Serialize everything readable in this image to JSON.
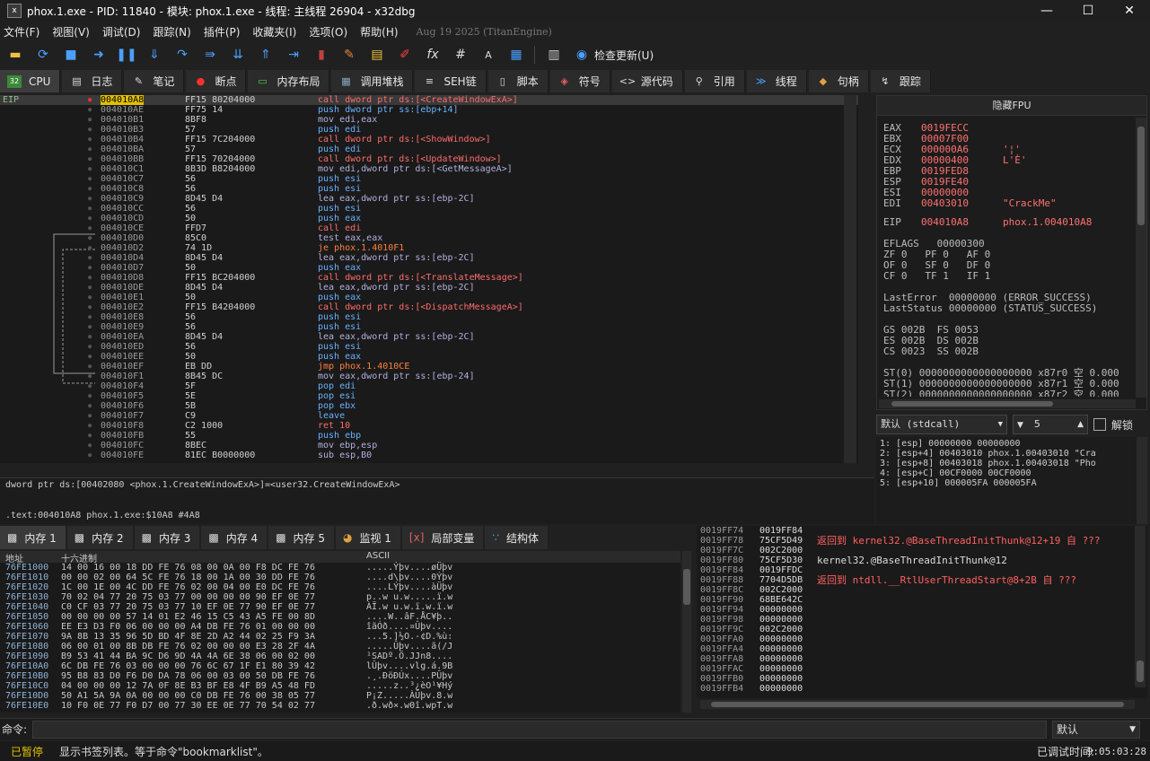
{
  "window": {
    "title": "phox.1.exe - PID: 11840 - 模块: phox.1.exe - 线程: 主线程 26904 - x32dbg",
    "minimize": "—",
    "maximize": "☐",
    "close": "✕"
  },
  "menu": {
    "items": [
      "文件(F)",
      "视图(V)",
      "调试(D)",
      "跟踪(N)",
      "插件(P)",
      "收藏夹(I)",
      "选项(O)",
      "帮助(H)"
    ],
    "build_date": "Aug 19 2025 (TitanEngine)"
  },
  "toolbar": {
    "check_update": "检查更新(U)"
  },
  "tabs": [
    {
      "label": "CPU",
      "icon": "cpu-icon"
    },
    {
      "label": "日志",
      "icon": "log-icon"
    },
    {
      "label": "笔记",
      "icon": "notes-icon"
    },
    {
      "label": "断点",
      "icon": "breakpoint-icon"
    },
    {
      "label": "内存布局",
      "icon": "memory-map-icon"
    },
    {
      "label": "调用堆栈",
      "icon": "callstack-icon"
    },
    {
      "label": "SEH链",
      "icon": "seh-icon"
    },
    {
      "label": "脚本",
      "icon": "script-icon"
    },
    {
      "label": "符号",
      "icon": "symbols-icon"
    },
    {
      "label": "源代码",
      "icon": "source-icon"
    },
    {
      "label": "引用",
      "icon": "references-icon"
    },
    {
      "label": "线程",
      "icon": "threads-icon"
    },
    {
      "label": "句柄",
      "icon": "handles-icon"
    },
    {
      "label": "跟踪",
      "icon": "trace-icon"
    }
  ],
  "disasm": {
    "eip_label": "EIP",
    "rows": [
      {
        "addr": "004010A8",
        "bytes": "FF15 80204000",
        "ins": "call dword ptr ds:[<CreateWindowExA>]",
        "kind": "call",
        "sel": true
      },
      {
        "addr": "004010AE",
        "bytes": "FF75 14",
        "ins": "push dword ptr ss:[ebp+14]",
        "kind": "push"
      },
      {
        "addr": "004010B1",
        "bytes": "8BF8",
        "ins": "mov edi,eax",
        "kind": "mov"
      },
      {
        "addr": "004010B3",
        "bytes": "57",
        "ins": "push edi",
        "kind": "push"
      },
      {
        "addr": "004010B4",
        "bytes": "FF15 7C204000",
        "ins": "call dword ptr ds:[<ShowWindow>]",
        "kind": "call"
      },
      {
        "addr": "004010BA",
        "bytes": "57",
        "ins": "push edi",
        "kind": "push"
      },
      {
        "addr": "004010BB",
        "bytes": "FF15 70204000",
        "ins": "call dword ptr ds:[<UpdateWindow>]",
        "kind": "call"
      },
      {
        "addr": "004010C1",
        "bytes": "8B3D B8204000",
        "ins": "mov edi,dword ptr ds:[<GetMessageA>]",
        "kind": "mov"
      },
      {
        "addr": "004010C7",
        "bytes": "56",
        "ins": "push esi",
        "kind": "push"
      },
      {
        "addr": "004010C8",
        "bytes": "56",
        "ins": "push esi",
        "kind": "push"
      },
      {
        "addr": "004010C9",
        "bytes": "8D45 D4",
        "ins": "lea eax,dword ptr ss:[ebp-2C]",
        "kind": "mov"
      },
      {
        "addr": "004010CC",
        "bytes": "56",
        "ins": "push esi",
        "kind": "push"
      },
      {
        "addr": "004010CD",
        "bytes": "50",
        "ins": "push eax",
        "kind": "push"
      },
      {
        "addr": "004010CE",
        "bytes": "FFD7",
        "ins": "call edi",
        "kind": "call"
      },
      {
        "addr": "004010D0",
        "bytes": "85C0",
        "ins": "test eax,eax",
        "kind": "mov"
      },
      {
        "addr": "004010D2",
        "bytes": "74 1D",
        "ins": "je phox.1.4010F1",
        "kind": "jmp"
      },
      {
        "addr": "004010D4",
        "bytes": "8D45 D4",
        "ins": "lea eax,dword ptr ss:[ebp-2C]",
        "kind": "mov"
      },
      {
        "addr": "004010D7",
        "bytes": "50",
        "ins": "push eax",
        "kind": "push"
      },
      {
        "addr": "004010D8",
        "bytes": "FF15 BC204000",
        "ins": "call dword ptr ds:[<TranslateMessage>]",
        "kind": "call"
      },
      {
        "addr": "004010DE",
        "bytes": "8D45 D4",
        "ins": "lea eax,dword ptr ss:[ebp-2C]",
        "kind": "mov"
      },
      {
        "addr": "004010E1",
        "bytes": "50",
        "ins": "push eax",
        "kind": "push"
      },
      {
        "addr": "004010E2",
        "bytes": "FF15 B4204000",
        "ins": "call dword ptr ds:[<DispatchMessageA>]",
        "kind": "call"
      },
      {
        "addr": "004010E8",
        "bytes": "56",
        "ins": "push esi",
        "kind": "push"
      },
      {
        "addr": "004010E9",
        "bytes": "56",
        "ins": "push esi",
        "kind": "push"
      },
      {
        "addr": "004010EA",
        "bytes": "8D45 D4",
        "ins": "lea eax,dword ptr ss:[ebp-2C]",
        "kind": "mov"
      },
      {
        "addr": "004010ED",
        "bytes": "56",
        "ins": "push esi",
        "kind": "push"
      },
      {
        "addr": "004010EE",
        "bytes": "50",
        "ins": "push eax",
        "kind": "push"
      },
      {
        "addr": "004010EF",
        "bytes": "EB DD",
        "ins": "jmp phox.1.4010CE",
        "kind": "jmp"
      },
      {
        "addr": "004010F1",
        "bytes": "8B45 DC",
        "ins": "mov eax,dword ptr ss:[ebp-24]",
        "kind": "mov"
      },
      {
        "addr": "004010F4",
        "bytes": "5F",
        "ins": "pop edi",
        "kind": "push"
      },
      {
        "addr": "004010F5",
        "bytes": "5E",
        "ins": "pop esi",
        "kind": "push"
      },
      {
        "addr": "004010F6",
        "bytes": "5B",
        "ins": "pop ebx",
        "kind": "push"
      },
      {
        "addr": "004010F7",
        "bytes": "C9",
        "ins": "leave",
        "kind": "push"
      },
      {
        "addr": "004010F8",
        "bytes": "C2 1000",
        "ins": "ret 10",
        "kind": "ret"
      },
      {
        "addr": "004010FB",
        "bytes": "55",
        "ins": "push ebp",
        "kind": "push"
      },
      {
        "addr": "004010FC",
        "bytes": "8BEC",
        "ins": "mov ebp,esp",
        "kind": "mov"
      },
      {
        "addr": "004010FE",
        "bytes": "81EC B0000000",
        "ins": "sub esp,B0",
        "kind": "mov"
      }
    ]
  },
  "info": {
    "line1": "dword ptr ds:[00402080 <phox.1.CreateWindowExA>]=<user32.CreateWindowExA>",
    "line2": ".text:004010A8 phox.1.exe:$10A8 #4A8"
  },
  "fpu": {
    "header": "隐藏FPU",
    "regs": [
      {
        "n": "EAX",
        "v": "0019FECC",
        "c": ""
      },
      {
        "n": "EBX",
        "v": "00007F00",
        "c": ""
      },
      {
        "n": "ECX",
        "v": "000000A6",
        "c": "'¦'"
      },
      {
        "n": "EDX",
        "v": "00000400",
        "c": "L'Ѐ'"
      },
      {
        "n": "EBP",
        "v": "0019FED8",
        "c": ""
      },
      {
        "n": "ESP",
        "v": "0019FE40",
        "c": ""
      },
      {
        "n": "ESI",
        "v": "00000000",
        "c": ""
      },
      {
        "n": "EDI",
        "v": "00403010",
        "c": "\"CrackMe\""
      }
    ],
    "eip": {
      "n": "EIP",
      "v": "004010A8",
      "c": "phox.1.004010A8"
    },
    "eflags": "EFLAGS   00000300",
    "flags1": "ZF 0   PF 0   AF 0",
    "flags2": "OF 0   SF 0   DF 0",
    "flags3": "CF 0   TF 1   IF 1",
    "lasterror": "LastError  00000000 (ERROR_SUCCESS)",
    "laststatus": "LastStatus 00000000 (STATUS_SUCCESS)",
    "seg1": "GS 002B  FS 0053",
    "seg2": "ES 002B  DS 002B",
    "seg3": "CS 0023  SS 002B",
    "st0": "ST(0) 0000000000000000000 x87r0 空 0.000",
    "st1": "ST(1) 0000000000000000000 x87r1 空 0.000",
    "st2": "ST(2) 0000000000000000000 x87r2 空 0.000"
  },
  "callconv": {
    "value": "默认 (stdcall)",
    "count": "5",
    "unlock": "解锁"
  },
  "stack_args": [
    "1: [esp] 00000000 00000000",
    "2: [esp+4] 00403010 phox.1.00403010 \"Cra",
    "3: [esp+8] 00403018 phox.1.00403018 \"Pho",
    "4: [esp+C] 00CF0000 00CF0000",
    "5: [esp+10] 000005FA 000005FA"
  ],
  "dump_tabs": [
    "内存 1",
    "内存 2",
    "内存 3",
    "内存 4",
    "内存 5",
    "监视 1",
    "局部变量",
    "结构体"
  ],
  "dump": {
    "col_addr": "地址",
    "col_hex": "十六进制",
    "col_ascii": "ASCII",
    "rows": [
      {
        "a": "76FE1000",
        "h": "14 00 16 00 18 DD FE 76 08 00 0A 00 F8 DC FE 76",
        "s": ".....Ýþv....øÜþv"
      },
      {
        "a": "76FE1010",
        "h": "00 00 02 00 64 5C FE 76 18 00 1A 00 30 DD FE 76",
        "s": "....d\\þv....0Ýþv"
      },
      {
        "a": "76FE1020",
        "h": "1C 00 1E 00 4C DD FE 76 02 00 04 00 E0 DC FE 76",
        "s": "....LÝþv....àÜþv"
      },
      {
        "a": "76FE1030",
        "h": "70 02 04 77 20 75 03 77 00 00 00 00 90 EF 0E 77",
        "s": "p..w u.w.....ï.w"
      },
      {
        "a": "76FE1040",
        "h": "C0 CF 03 77 20 75 03 77 10 EF 0E 77 90 EF 0E 77",
        "s": "ÀÏ.w u.w.ï.w.ï.w"
      },
      {
        "a": "76FE1050",
        "h": "00 00 00 00 57 14 01 E2 46 15 C5 43 A5 FE 00 8D",
        "s": "....W..âF.ÅC¥þ.."
      },
      {
        "a": "76FE1060",
        "h": "EE E3 D3 F0 06 00 00 00 A4 DB FE 76 01 00 00 00",
        "s": "îãÓð....¤Ûþv...."
      },
      {
        "a": "76FE1070",
        "h": "9A 8B 13 35 96 5D BD 4F 8E 2D A2 44 02 25 F9 3A",
        "s": "...5.]½O.-¢D.%ù:"
      },
      {
        "a": "76FE1080",
        "h": "06 00 01 00 8B DB FE 76 02 00 00 00 E3 28 2F 4A",
        "s": ".....Ûþv....ã(/J"
      },
      {
        "a": "76FE1090",
        "h": "B9 53 41 44 BA 9C D6 9D 4A 4A 6E 38 06 00 02 00",
        "s": "¹SADº.Ö.JJn8...."
      },
      {
        "a": "76FE10A0",
        "h": "6C DB FE 76 03 00 00 00 76 6C 67 1F E1 80 39 42",
        "s": "lÛþv....vlg.á.9B"
      },
      {
        "a": "76FE10B0",
        "h": "95 B8 83 D0 F6 D0 DA 78 06 00 03 00 50 DB FE 76",
        "s": ".¸.ÐöÐÚx....PÛþv"
      },
      {
        "a": "76FE10C0",
        "h": "04 00 00 00 12 7A 0F 8E B3 BF E8 4F B9 A5 48 FD",
        "s": ".....z..³¿èO¹¥Hý"
      },
      {
        "a": "76FE10D0",
        "h": "50 A1 5A 9A 0A 00 00 00 C0 DB FE 76 00 38 05 77",
        "s": "P¡Z.....ÀÛþv.8.w"
      },
      {
        "a": "76FE10E0",
        "h": "10 F0 0E 77 F0 D7 00 77 30 EE 0E 77 70 54 02 77",
        "s": ".ð.wð×.w0î.wpT.w"
      }
    ]
  },
  "stack": {
    "rows": [
      {
        "a": "0019FF74",
        "v": "0019FF84",
        "c": ""
      },
      {
        "a": "0019FF78",
        "v": "75CF5D49",
        "c": "返回到 kernel32.@BaseThreadInitThunk@12+19 自 ???"
      },
      {
        "a": "0019FF7C",
        "v": "002C2000",
        "c": ""
      },
      {
        "a": "0019FF80",
        "v": "75CF5D30",
        "c": "kernel32.@BaseThreadInitThunk@12"
      },
      {
        "a": "0019FF84",
        "v": "0019FFDC",
        "c": ""
      },
      {
        "a": "0019FF88",
        "v": "7704D5DB",
        "c": "返回到 ntdll.__RtlUserThreadStart@8+2B 自 ???"
      },
      {
        "a": "0019FF8C",
        "v": "002C2000",
        "c": ""
      },
      {
        "a": "0019FF90",
        "v": "68BE642C",
        "c": ""
      },
      {
        "a": "0019FF94",
        "v": "00000000",
        "c": ""
      },
      {
        "a": "0019FF98",
        "v": "00000000",
        "c": ""
      },
      {
        "a": "0019FF9C",
        "v": "002C2000",
        "c": ""
      },
      {
        "a": "0019FFA0",
        "v": "00000000",
        "c": ""
      },
      {
        "a": "0019FFA4",
        "v": "00000000",
        "c": ""
      },
      {
        "a": "0019FFA8",
        "v": "00000000",
        "c": ""
      },
      {
        "a": "0019FFAC",
        "v": "00000000",
        "c": ""
      },
      {
        "a": "0019FFB0",
        "v": "00000000",
        "c": ""
      },
      {
        "a": "0019FFB4",
        "v": "00000000",
        "c": ""
      }
    ]
  },
  "command": {
    "label": "命令:",
    "placeholder": "",
    "mode": "默认"
  },
  "status": {
    "state": "已暂停",
    "message": "显示书签列表。等于命令\"bookmarklist\"。",
    "time_label": "已调试时间:",
    "time": "9:05:03:28"
  },
  "colors": {
    "accent": "#e0c000",
    "call": "#ff6b6b",
    "push": "#6ab0ff",
    "register_value": "#ff7070",
    "paused": "#e0c000"
  }
}
